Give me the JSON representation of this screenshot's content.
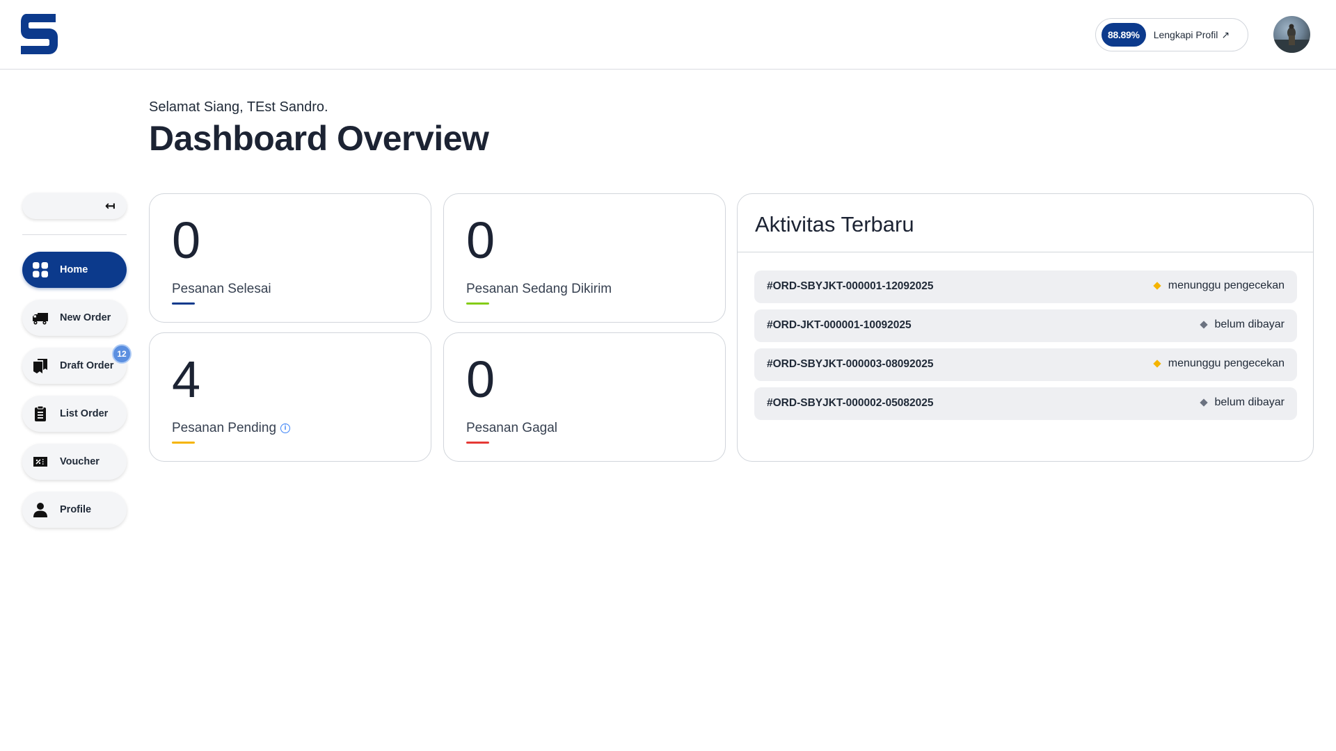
{
  "header": {
    "logo": "s-logo",
    "profile_completion": {
      "percent": "88.89%",
      "label": "Lengkapi Profil",
      "arrow": "↗"
    },
    "avatar": "user-avatar"
  },
  "greeting": "Selamat Siang, TEst Sandro.",
  "page_title": "Dashboard Overview",
  "sidebar": {
    "collapse_icon": "↤",
    "items": [
      {
        "label": "Home",
        "icon": "grid-icon",
        "active": true
      },
      {
        "label": "New Order",
        "icon": "truck-icon"
      },
      {
        "label": "Draft Order",
        "icon": "folder-icon",
        "badge": "12"
      },
      {
        "label": "List Order",
        "icon": "clipboard-icon"
      },
      {
        "label": "Voucher",
        "icon": "ticket-icon"
      },
      {
        "label": "Profile",
        "icon": "person-icon"
      }
    ]
  },
  "stats": [
    {
      "value": "0",
      "label": "Pesanan Selesai",
      "color": "#0c3a8c"
    },
    {
      "value": "0",
      "label": "Pesanan Sedang Dikirim",
      "color": "#84cc16"
    },
    {
      "value": "4",
      "label": "Pesanan Pending",
      "color": "#f5b400",
      "info_icon": "i"
    },
    {
      "value": "0",
      "label": "Pesanan Gagal",
      "color": "#e53935"
    }
  ],
  "activity": {
    "title": "Aktivitas Terbaru",
    "rows": [
      {
        "id": "#ORD-SBYJKT-000001-12092025",
        "status": "menunggu pengecekan",
        "dot_color": "#f5b400"
      },
      {
        "id": "#ORD-JKT-000001-10092025",
        "status": "belum dibayar",
        "dot_color": "#6b7280"
      },
      {
        "id": "#ORD-SBYJKT-000003-08092025",
        "status": "menunggu pengecekan",
        "dot_color": "#f5b400"
      },
      {
        "id": "#ORD-SBYJKT-000002-05082025",
        "status": "belum dibayar",
        "dot_color": "#6b7280"
      }
    ]
  }
}
